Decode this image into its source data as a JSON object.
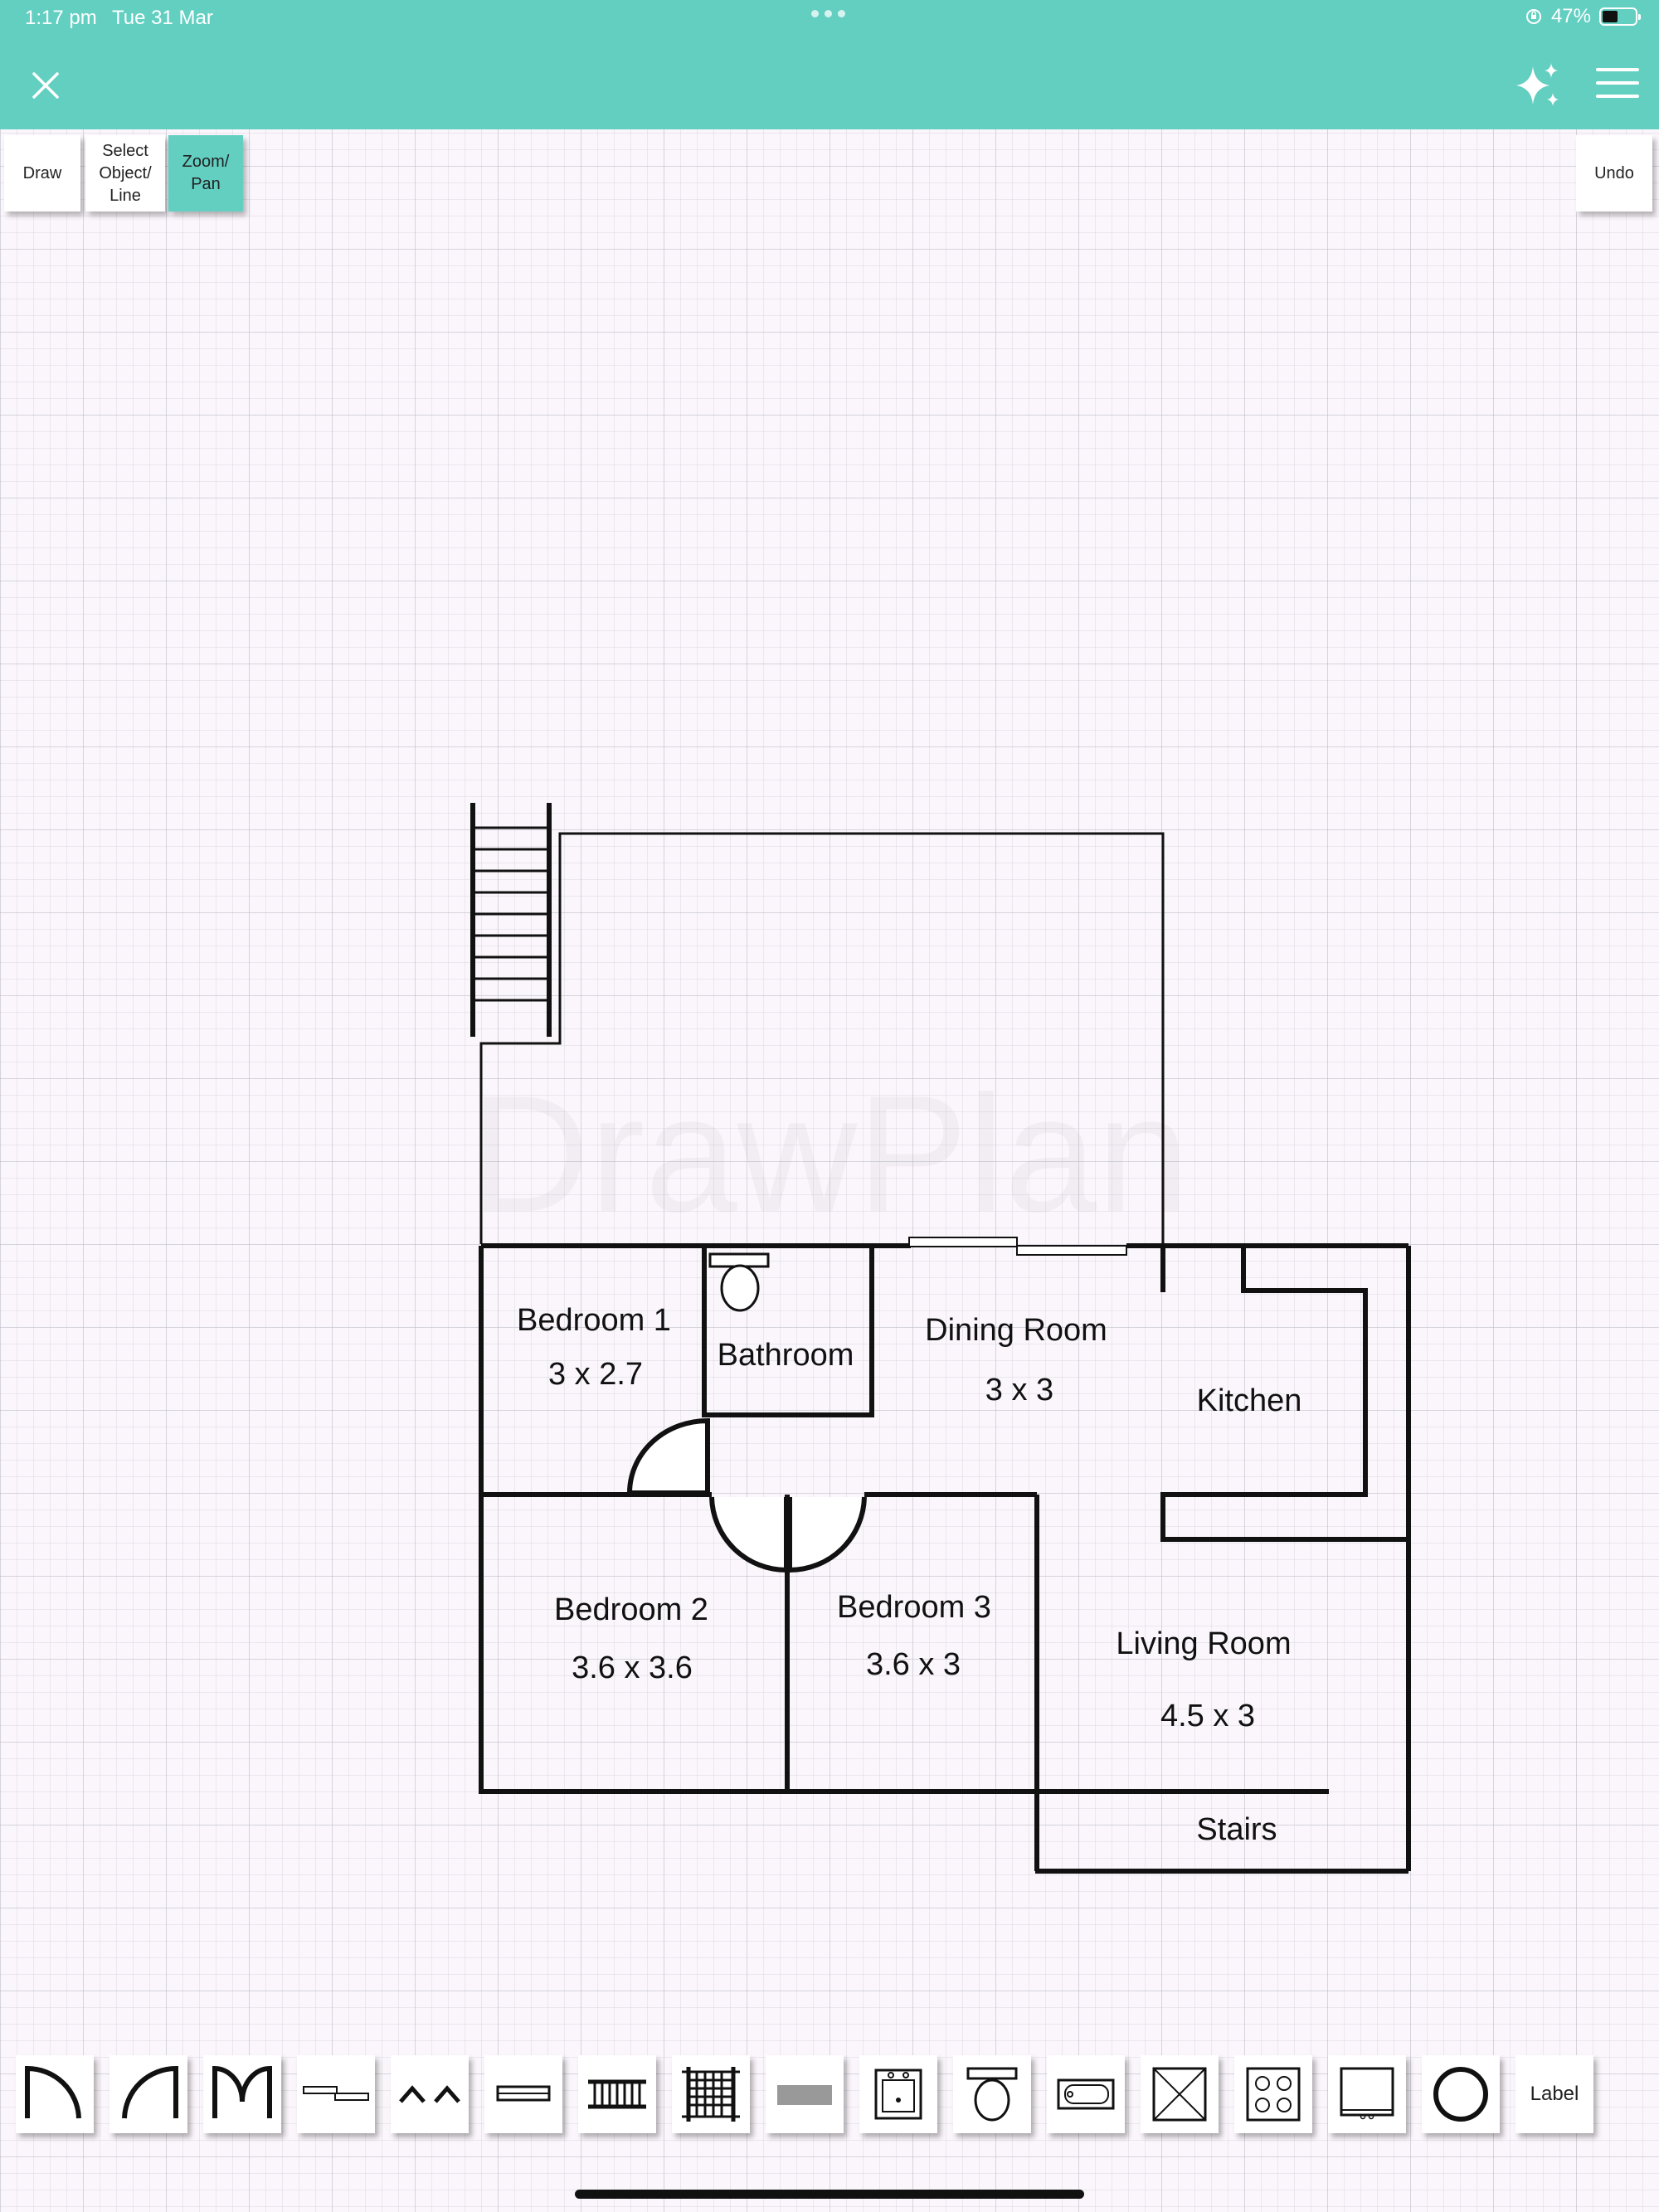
{
  "status_bar": {
    "time": "1:17 pm",
    "date": "Tue 31 Mar",
    "battery_text": "47%",
    "battery_level": 0.47
  },
  "header": {
    "close_icon": "close-icon",
    "magic_icon": "sparkles-icon",
    "menu_icon": "hamburger-menu-icon",
    "color": "#62cfc1"
  },
  "toolbar": {
    "draw_label": "Draw",
    "select_label_1": "Select",
    "select_label_2": "Object/",
    "select_label_3": "Line",
    "zoom_label_1": "Zoom/",
    "zoom_label_2": "Pan",
    "undo_label": "Undo",
    "active_tool": "Zoom/Pan"
  },
  "canvas": {
    "watermark": "DrawPlan",
    "rooms": [
      {
        "name": "Bedroom 1",
        "size": "3 x 2.7"
      },
      {
        "name": "Bathroom"
      },
      {
        "name": "Dining Room",
        "size": "3 x 3"
      },
      {
        "name": "Kitchen"
      },
      {
        "name": "Bedroom 2",
        "size": "3.6 x 3.6"
      },
      {
        "name": "Bedroom 3",
        "size": "3.6 x 3"
      },
      {
        "name": "Living Room",
        "size": "4.5 x 3"
      },
      {
        "name": "Stairs"
      }
    ]
  },
  "palette": {
    "items": [
      {
        "icon": "door-swing-left-icon"
      },
      {
        "icon": "door-swing-right-icon"
      },
      {
        "icon": "double-door-icon"
      },
      {
        "icon": "sliding-door-icon"
      },
      {
        "icon": "bifold-door-icon"
      },
      {
        "icon": "window-icon"
      },
      {
        "icon": "straight-stairs-icon"
      },
      {
        "icon": "vertical-stairs-icon"
      },
      {
        "icon": "bench-icon"
      },
      {
        "icon": "sink-icon"
      },
      {
        "icon": "toilet-icon"
      },
      {
        "icon": "bathtub-icon"
      },
      {
        "icon": "shower-icon"
      },
      {
        "icon": "stove-icon"
      },
      {
        "icon": "tv-icon"
      },
      {
        "icon": "circle-shape-icon"
      }
    ],
    "label_button": "Label"
  }
}
